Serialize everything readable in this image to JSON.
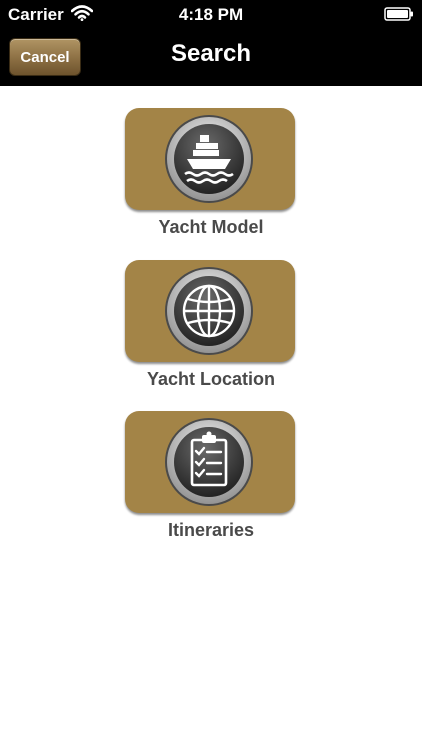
{
  "status_bar": {
    "carrier": "Carrier",
    "time": "4:18 PM"
  },
  "nav": {
    "cancel_label": "Cancel",
    "title": "Search"
  },
  "options": [
    {
      "label": "Yacht Model",
      "icon": "ship-icon"
    },
    {
      "label": "Yacht Location",
      "icon": "globe-icon"
    },
    {
      "label": "Itineraries",
      "icon": "clipboard-checklist-icon"
    }
  ],
  "colors": {
    "header": "#000000",
    "tile": "#a38447",
    "label": "#4a4a4a"
  }
}
